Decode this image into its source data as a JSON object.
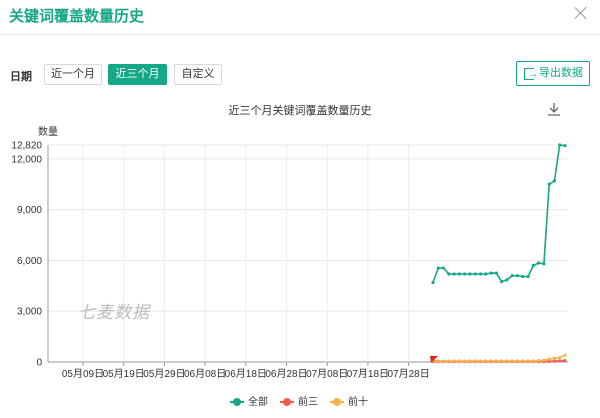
{
  "header": {
    "title": "关键词覆盖数量历史"
  },
  "filters": {
    "label": "日期",
    "buttons": [
      {
        "label": "近一个月",
        "active": false
      },
      {
        "label": "近三个月",
        "active": true
      },
      {
        "label": "自定义",
        "active": false
      }
    ],
    "export_label": "导出数据"
  },
  "watermark": "七麦数据",
  "chart_data": {
    "type": "line",
    "title": "近三个月关键词覆盖数量历史",
    "ylabel": "数量",
    "ylim": [
      0,
      12820
    ],
    "y_ticks": [
      0,
      3000,
      6000,
      9000,
      12000,
      12820
    ],
    "y_tick_labels": [
      "0",
      "3,000",
      "6,000",
      "9,000",
      "12,000",
      "12,820"
    ],
    "x_tick_labels": [
      "05月09日",
      "05月19日",
      "05月29日",
      "06月08日",
      "06月18日",
      "06月28日",
      "07月08日",
      "07月18日",
      "07月28日"
    ],
    "series": [
      {
        "name": "全部",
        "color": "#15a886",
        "values": [
          4700,
          5550,
          5550,
          5200,
          5200,
          5200,
          5200,
          5200,
          5200,
          5200,
          5200,
          5250,
          5250,
          4750,
          4850,
          5100,
          5100,
          5050,
          5050,
          5700,
          5850,
          5800,
          10500,
          10700,
          12820,
          12780
        ]
      },
      {
        "name": "前三",
        "color": "#f0604d",
        "values": [
          20,
          20,
          20,
          20,
          20,
          20,
          20,
          20,
          20,
          20,
          20,
          20,
          20,
          20,
          20,
          20,
          20,
          20,
          20,
          20,
          20,
          20,
          40,
          50,
          70,
          80
        ]
      },
      {
        "name": "前十",
        "color": "#f8b24f",
        "values": [
          80,
          60,
          60,
          60,
          60,
          60,
          60,
          60,
          60,
          60,
          60,
          60,
          60,
          60,
          60,
          60,
          60,
          60,
          60,
          60,
          80,
          100,
          180,
          220,
          260,
          400
        ]
      }
    ],
    "legend_position": "bottom",
    "grid": true
  }
}
